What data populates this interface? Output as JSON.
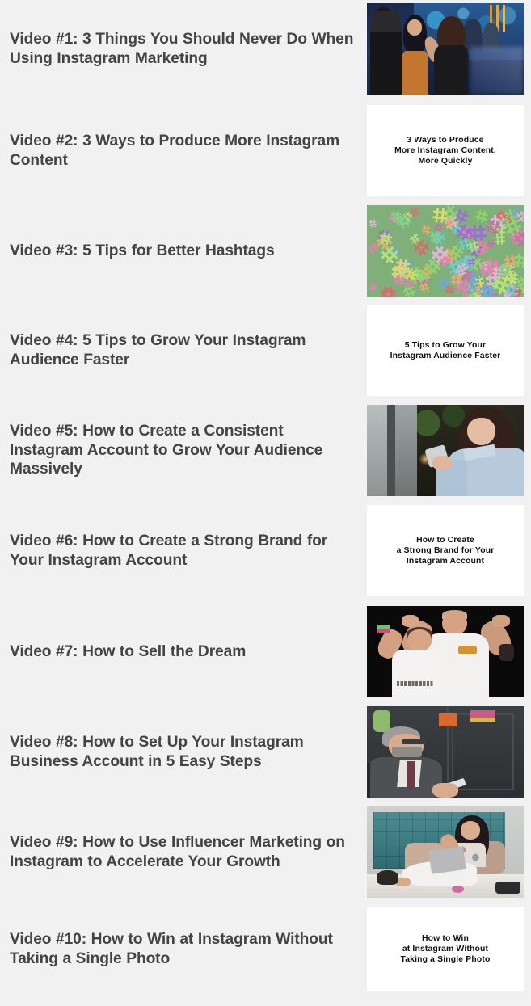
{
  "page": {
    "background_color": "#f1f1f1",
    "heading_color": "#444444",
    "thumbnail_background": "#ffffff"
  },
  "videos": [
    {
      "title": "Video #1: 3 Things You Should Never Do When Using Instagram Marketing",
      "thumbnail_type": "photo",
      "thumbnail_alt": "crowd of people dancing at a club with blue stage lights"
    },
    {
      "title": "Video #2: 3 Ways to Produce More Instagram Content",
      "thumbnail_type": "text-card",
      "thumbnail_text": "3 Ways to Produce\nMore Instagram Content,\nMore Quickly"
    },
    {
      "title": "Video #3: 5 Tips for Better Hashtags",
      "thumbnail_type": "photo",
      "thumbnail_alt": "pile of colorful pastel hashtag symbols"
    },
    {
      "title": "Video #4: 5 Tips to Grow Your Instagram Audience Faster",
      "thumbnail_type": "text-card",
      "thumbnail_text": "5 Tips to Grow Your\nInstagram Audience Faster"
    },
    {
      "title": "Video #5: How to Create a Consistent Instagram Account to Grow Your Audience Massively",
      "thumbnail_type": "photo",
      "thumbnail_alt": "woman in light blue shirt looking at her phone by a window"
    },
    {
      "title": "Video #6: How to Create a Strong Brand for Your Instagram Account",
      "thumbnail_type": "text-card",
      "thumbnail_text": "How to Create\na Strong Brand for Your\nInstagram Account"
    },
    {
      "title": "Video #7: How to Sell the Dream",
      "thumbnail_type": "photo",
      "thumbnail_alt": "couple in white t-shirts flexing arms on a dark background"
    },
    {
      "title": "Video #8: How to Set Up Your Instagram Business Account in 5 Easy Steps",
      "thumbnail_type": "photo",
      "thumbnail_alt": "man in a grey suit seated, using a smartphone in a dark room"
    },
    {
      "title": "Video #9: How to Use Influencer Marketing on Instagram to Accelerate Your Growth",
      "thumbnail_type": "photo",
      "thumbnail_alt": "woman in white trousers sitting on a teal bed with a laptop and phone"
    },
    {
      "title": "Video #10: How to Win at Instagram Without Taking a Single Photo",
      "thumbnail_type": "text-card",
      "thumbnail_text": "How to Win\nat Instagram Without\nTaking a Single Photo"
    }
  ]
}
